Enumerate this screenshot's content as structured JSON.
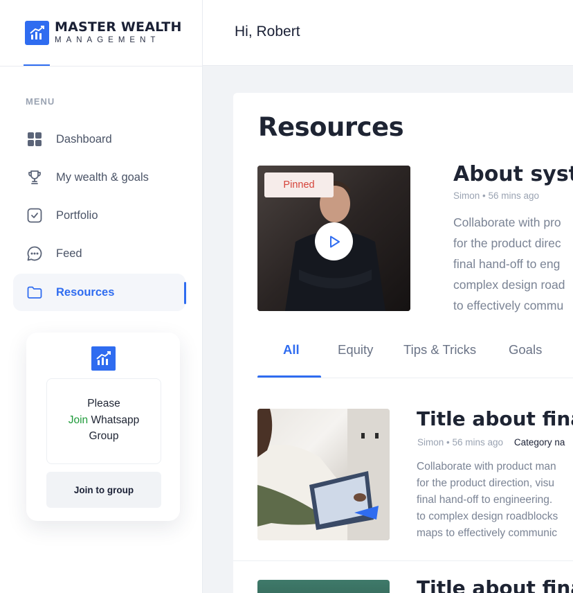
{
  "brand": {
    "title": "MASTER WEALTH",
    "subtitle": "MANAGEMENT",
    "logo_icon": "bar-chart-trend-icon",
    "accent": "#2f6cf0"
  },
  "header": {
    "greeting": "Hi, Robert"
  },
  "sidebar": {
    "menu_label": "MENU",
    "items": [
      {
        "label": "Dashboard",
        "icon": "grid-icon",
        "active": false
      },
      {
        "label": "My wealth & goals",
        "icon": "trophy-icon",
        "active": false
      },
      {
        "label": "Portfolio",
        "icon": "checkbox-icon",
        "active": false
      },
      {
        "label": "Feed",
        "icon": "chat-bubble-icon",
        "active": false
      },
      {
        "label": "Resources",
        "icon": "folder-icon",
        "active": true
      }
    ],
    "promo": {
      "line1": "Please",
      "join_word": "Join",
      "line2_rest": " Whatsapp",
      "line3": "Group",
      "button_label": "Join to group"
    }
  },
  "main": {
    "title": "Resources",
    "featured": {
      "badge": "Pinned",
      "title": "About syste",
      "author": "Simon",
      "time": "56 mins ago",
      "description_lines": [
        "Collaborate with pro",
        "for the product direc",
        "final hand-off to eng",
        "complex design road",
        "to effectively commu"
      ]
    },
    "tabs": [
      {
        "label": "All",
        "active": true
      },
      {
        "label": "Equity",
        "active": false
      },
      {
        "label": "Tips & Tricks",
        "active": false
      },
      {
        "label": "Goals",
        "active": false
      }
    ],
    "cards": [
      {
        "title": "Title about fina",
        "author": "Simon",
        "time": "56 mins ago",
        "category": "Category na",
        "description_lines": [
          "Collaborate with product man",
          "for the product direction, visu",
          "final hand-off to engineering.",
          "to complex design roadblocks",
          "maps to effectively communic"
        ]
      },
      {
        "title": "Title about fina"
      }
    ]
  }
}
